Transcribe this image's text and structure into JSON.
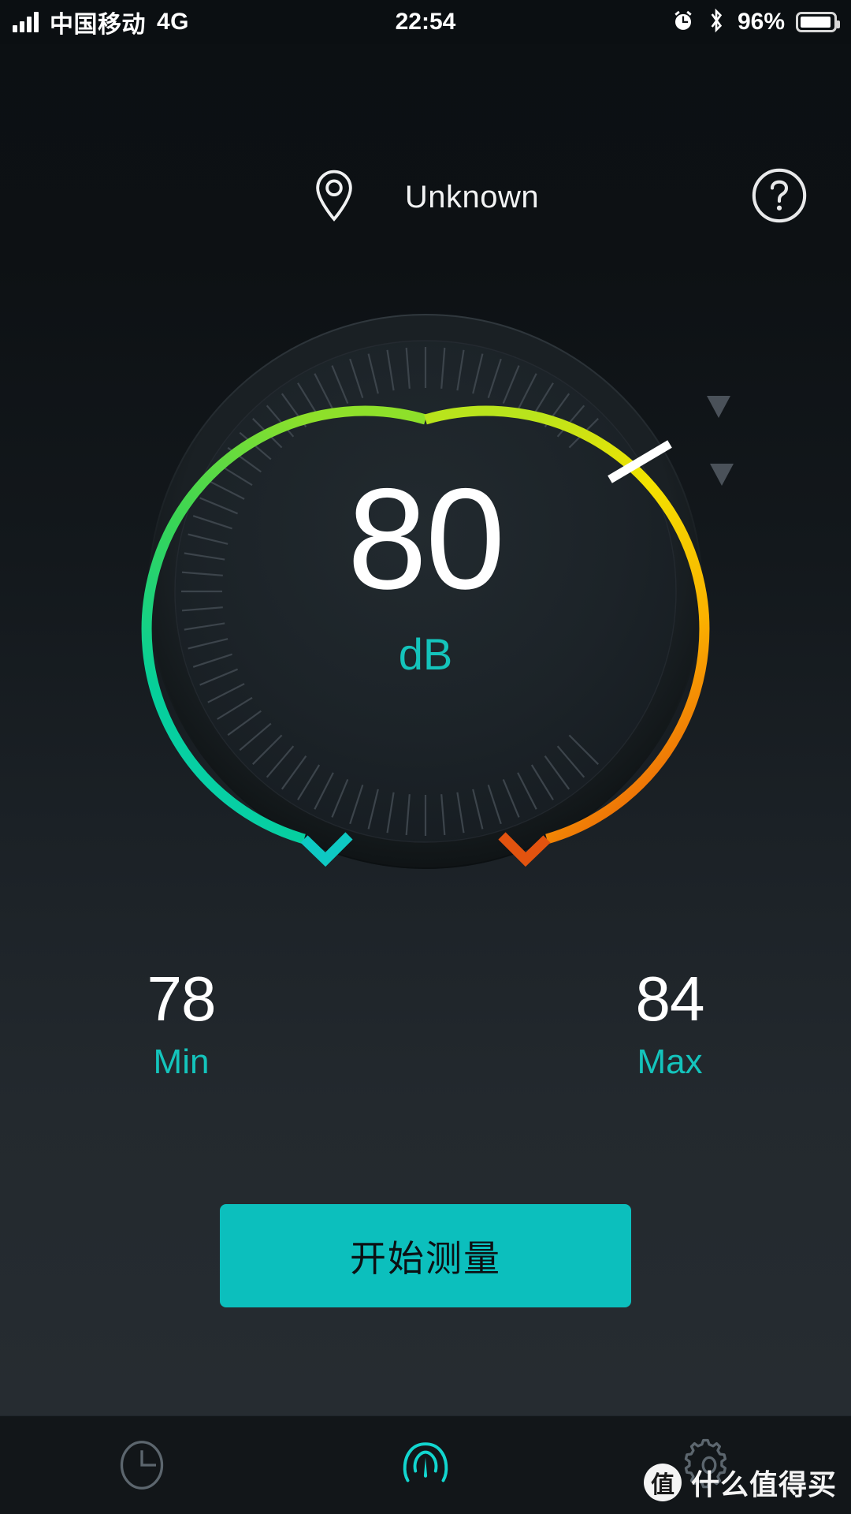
{
  "status_bar": {
    "carrier": "中国移动",
    "network": "4G",
    "time": "22:54",
    "battery_percent": "96%",
    "signal_icon": "signal-bars-icon",
    "alarm_icon": "alarm-clock-icon",
    "bluetooth_icon": "bluetooth-icon",
    "battery_icon": "battery-icon"
  },
  "header": {
    "location_icon": "location-pin-icon",
    "location_label": "Unknown",
    "help_icon": "help-circle-icon"
  },
  "gauge": {
    "value": "80",
    "unit": "dB",
    "needle_value": 98,
    "arc_start_color": "#00d2a0",
    "arc_mid_color": "#f2e300",
    "arc_end_color": "#e34c0c",
    "tick_color": "#3a4147",
    "needle_color": "#ffffff",
    "marker_color": "#4a5158"
  },
  "stats": {
    "min": {
      "value": "78",
      "label": "Min"
    },
    "max": {
      "value": "84",
      "label": "Max"
    },
    "label_color": "#14c4bc"
  },
  "action": {
    "label": "开始测量",
    "bg_color": "#0cbfbd",
    "text_color": "#0c1013"
  },
  "tabbar": {
    "items": [
      {
        "name": "history",
        "icon": "clock-icon",
        "active": false
      },
      {
        "name": "measure",
        "icon": "gauge-icon",
        "active": true
      },
      {
        "name": "settings",
        "icon": "gear-icon",
        "active": false
      }
    ],
    "active_color": "#12d6cf",
    "inactive_color": "#5c666e"
  },
  "watermark": {
    "badge": "值",
    "text": "什么值得买"
  },
  "chart_data": {
    "type": "gauge",
    "title": "Sound level meter",
    "current": 80,
    "unit": "dB",
    "min_recorded": 78,
    "max_recorded": 84,
    "scale_min": 30,
    "scale_max": 130,
    "arc_sweep_degrees": 270,
    "arc_start_angle_deg": 135,
    "color_stops": [
      {
        "pos": 0.0,
        "color": "#00d2a0"
      },
      {
        "pos": 0.33,
        "color": "#56d936"
      },
      {
        "pos": 0.55,
        "color": "#f2e300"
      },
      {
        "pos": 0.8,
        "color": "#f5a300"
      },
      {
        "pos": 1.0,
        "color": "#e34c0c"
      }
    ],
    "tick_count": 60,
    "needle_angle_deg": 30
  }
}
